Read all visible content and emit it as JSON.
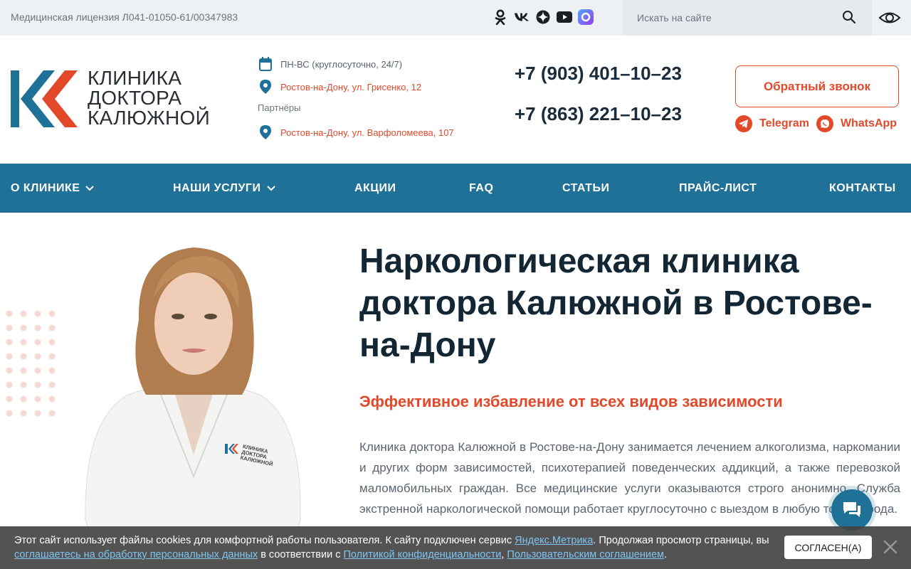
{
  "topbar": {
    "license": "Медицинская лицензия Л041-01050-61/00347983",
    "socials": [
      "odnoklassniki-icon",
      "vk-icon",
      "dzen-icon",
      "youtube-icon",
      "max-icon"
    ],
    "search_placeholder": "Искать на сайте"
  },
  "logo": {
    "line1": "КЛИНИКА",
    "line2": "ДОКТОРА",
    "line3": "КАЛЮЖНОЙ",
    "colors": {
      "blue": "#1f7197",
      "orange": "#e2492b"
    }
  },
  "info": {
    "hours": "ПН-ВС (круглосуточно, 24/7)",
    "address_main": "Ростов-на-Дону, ул. Грисенко, 12",
    "partners_label": "Партнёры",
    "address_partner": "Ростов-на-Дону, ул. Варфоломеева, 107"
  },
  "phones": [
    "+7 (903) 401–10–23",
    "+7 (863) 221–10–23"
  ],
  "callback_label": "Обратный звонок",
  "messengers": {
    "telegram": "Telegram",
    "whatsapp": "WhatsApp"
  },
  "nav": [
    "О КЛИНИКЕ",
    "НАШИ УСЛУГИ",
    "АКЦИИ",
    "FAQ",
    "СТАТЬИ",
    "ПРАЙС-ЛИСТ",
    "КОНТАКТЫ"
  ],
  "hero": {
    "title": "Наркологическая клиника доктора Калюжной в Ростове-на-Дону",
    "subtitle": "Эффективное избавление от всех видов зависимости",
    "description": "Клиника доктора Калюжной в Ростове-на-Дону занимается лечением алкоголизма, наркомании и других форм зависимостей, психотерапией поведенческих аддикций, а также перевозкой маломобильных граждан. Все медицинские услуги оказываются строго анонимно. Служба экстренной наркологической помощи работает круглосуточно с выездом в любую точку города.",
    "badge_line1": "КЛИНИКА",
    "badge_line2": "ДОКТОРА",
    "badge_line3": "КАЛЮЖНОЙ"
  },
  "cookie": {
    "part1": "Этот сайт использует файлы cookies для комфортной работы пользователя. К сайту подключен сервис ",
    "link_metrika": "Яндекс.Метрика",
    "part2": ". Продолжая просмотр страницы, вы ",
    "link_consent": "соглашаетесь на обработку персональных данных",
    "part3": " в соответствии с ",
    "link_privacy": "Политикой конфиденциальности",
    "part4": ", ",
    "link_agreement": "Пользовательским соглашением",
    "part5": ".",
    "agree_label": "СОГЛАСЕН(А)"
  }
}
